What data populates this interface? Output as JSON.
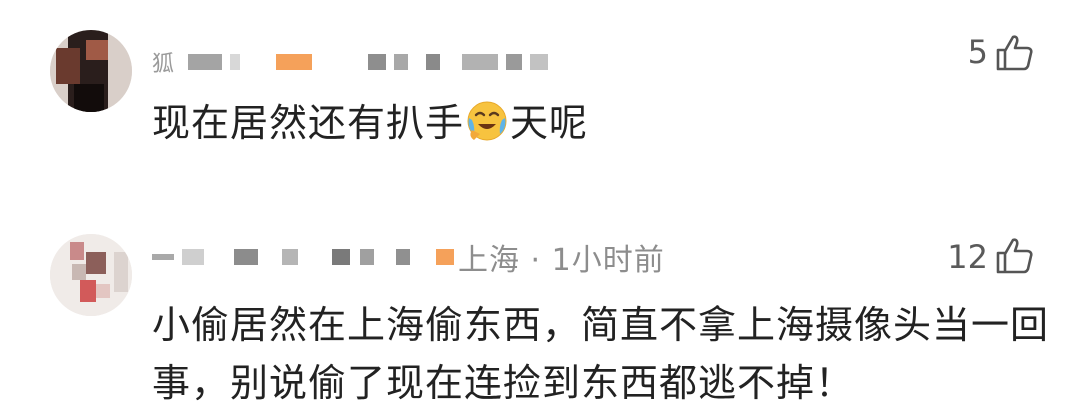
{
  "comments": [
    {
      "name_prefix": "狐",
      "likes": "5",
      "text_before": "现在居然还有扒手",
      "emoji": "face-with-tears-emoji",
      "text_after": "天呢"
    },
    {
      "meta_location_time": "上海 · 1小时前",
      "likes": "12",
      "text": "小偷居然在上海偷东西，简直不拿上海摄像头当一回事，别说偷了现在连捡到东西都逃不掉！"
    }
  ],
  "colors": {
    "text": "#222222",
    "meta": "#8d8d8d",
    "mosaic_orange": "#f5a15a",
    "mosaic_gray": "#9c9c9c"
  }
}
